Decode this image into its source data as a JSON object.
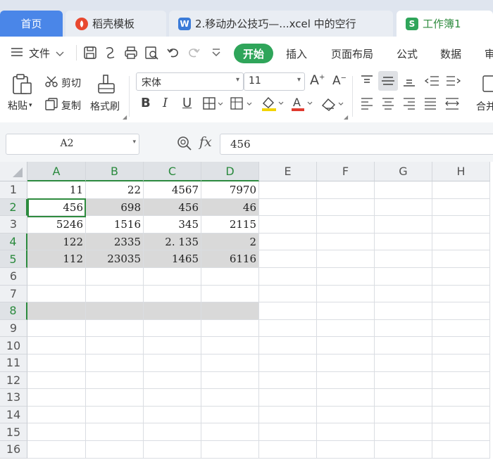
{
  "tabs": [
    {
      "label": "首页",
      "active": false
    },
    {
      "label": "稻壳模板",
      "icon": "docer-icon",
      "active": false
    },
    {
      "label": "2.移动办公技巧—...xcel 中的空行",
      "icon": "word-doc-icon",
      "active": false
    },
    {
      "label": "工作簿1",
      "icon": "spreadsheet-icon",
      "active": true
    }
  ],
  "menu": {
    "file_label": "文件",
    "items": [
      "开始",
      "插入",
      "页面布局",
      "公式",
      "数据",
      "审"
    ]
  },
  "ribbon": {
    "paste_label": "粘贴",
    "cut_label": "剪切",
    "copy_label": "复制",
    "format_painter_label": "格式刷",
    "font_name": "宋体",
    "font_size": "11",
    "merge_label": "合并"
  },
  "formula_bar": {
    "name_box": "A2",
    "fx_label": "fx",
    "formula": "456"
  },
  "columns": [
    "A",
    "B",
    "C",
    "D",
    "E",
    "F",
    "G",
    "H"
  ],
  "rows": [
    "1",
    "2",
    "3",
    "4",
    "5",
    "6",
    "7",
    "8",
    "9",
    "10",
    "11",
    "12",
    "13",
    "14",
    "15",
    "16"
  ],
  "cells": [
    [
      "11",
      "22",
      "4567",
      "7970"
    ],
    [
      "456",
      "698",
      "456",
      "46"
    ],
    [
      "5246",
      "1516",
      "345",
      "2115"
    ],
    [
      "122",
      "2335",
      "2. 135",
      "2"
    ],
    [
      "112",
      "23035",
      "1465",
      "6116"
    ],
    [
      "",
      "",
      "",
      ""
    ],
    [
      "",
      "",
      "",
      ""
    ],
    [
      "",
      "",
      "",
      ""
    ]
  ],
  "colors": {
    "accent_green": "#2e8b3e",
    "home_tab_blue": "#4a86e8",
    "selection_gray": "#d9d9d9"
  }
}
